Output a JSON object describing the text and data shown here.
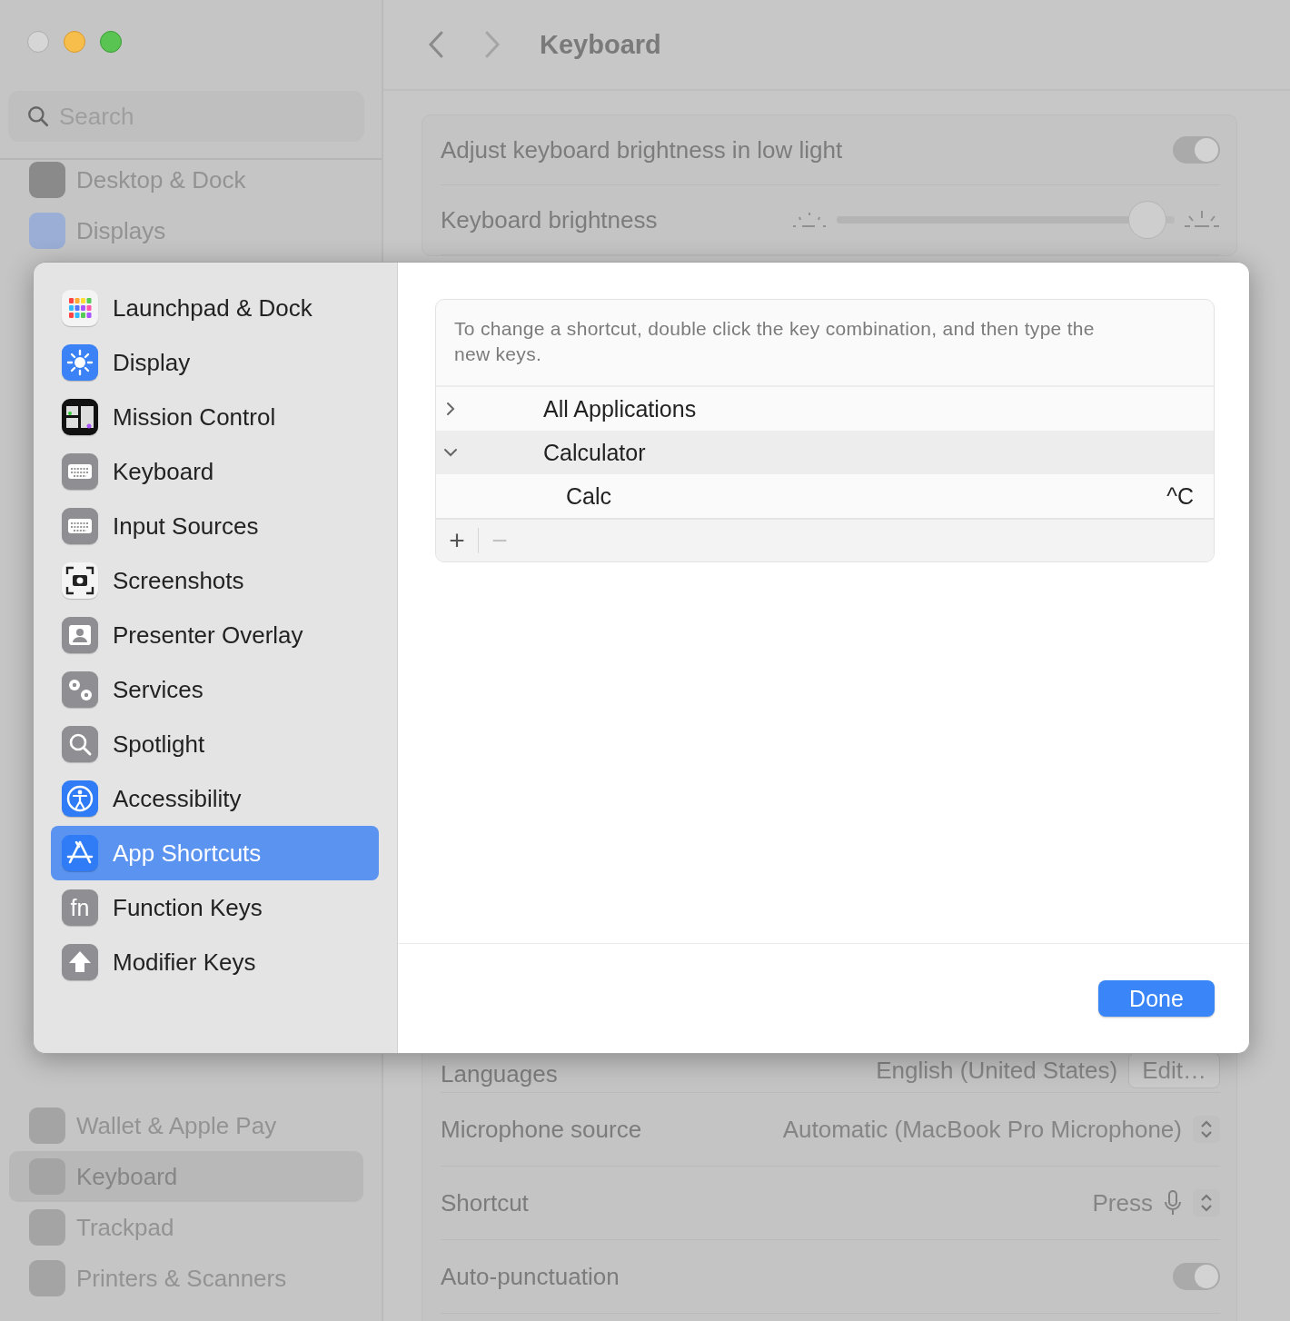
{
  "background_window": {
    "sidebar": {
      "search": {
        "placeholder": "Search"
      },
      "items_top": [
        {
          "label": "Desktop & Dock",
          "selected": false
        },
        {
          "label": "Displays",
          "selected": false
        }
      ],
      "items_bottom": [
        {
          "label": "Wallet & Apple Pay",
          "selected": false
        },
        {
          "label": "Keyboard",
          "selected": true
        },
        {
          "label": "Trackpad",
          "selected": false
        },
        {
          "label": "Printers & Scanners",
          "selected": false
        }
      ]
    },
    "toolbar": {
      "title": "Keyboard"
    },
    "settings_top": [
      {
        "kind": "toggle",
        "label": "Adjust keyboard brightness in low light",
        "on": true
      },
      {
        "kind": "slider",
        "label": "Keyboard brightness",
        "level": 0.97
      }
    ],
    "settings_bottom": [
      {
        "kind": "button",
        "label": "Languages",
        "value": "English (United States)",
        "button": "Edit…"
      },
      {
        "kind": "popup",
        "label": "Microphone source",
        "value": "Automatic (MacBook Pro Microphone)"
      },
      {
        "kind": "popup_mic",
        "label": "Shortcut",
        "value": "Press"
      },
      {
        "kind": "toggle",
        "label": "Auto-punctuation",
        "on": true
      }
    ]
  },
  "sheet": {
    "sidebar": [
      {
        "label": "Launchpad & Dock",
        "selected": false
      },
      {
        "label": "Display",
        "selected": false
      },
      {
        "label": "Mission Control",
        "selected": false
      },
      {
        "label": "Keyboard",
        "selected": false
      },
      {
        "label": "Input Sources",
        "selected": false
      },
      {
        "label": "Screenshots",
        "selected": false
      },
      {
        "label": "Presenter Overlay",
        "selected": false
      },
      {
        "label": "Services",
        "selected": false
      },
      {
        "label": "Spotlight",
        "selected": false
      },
      {
        "label": "Accessibility",
        "selected": false
      },
      {
        "label": "App Shortcuts",
        "selected": true
      },
      {
        "label": "Function Keys",
        "selected": false,
        "icon_text": "fn"
      },
      {
        "label": "Modifier Keys",
        "selected": false
      }
    ],
    "hint": "To change a shortcut, double click the key combination, and then type the new keys.",
    "tree": [
      {
        "label": "All Applications",
        "expanded": false,
        "selected": false
      },
      {
        "label": "Calculator",
        "expanded": true,
        "selected": true,
        "children": [
          {
            "label": "Calc",
            "shortcut": "^C"
          }
        ]
      }
    ],
    "add_button": "+",
    "remove_button": {
      "label": "−",
      "disabled": true
    },
    "done_button": "Done"
  }
}
